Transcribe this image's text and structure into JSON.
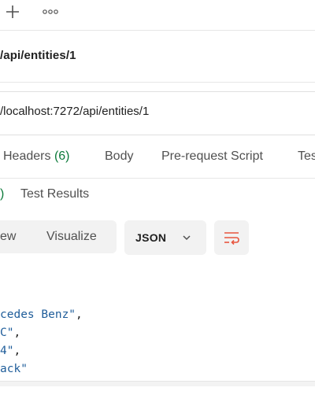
{
  "request": {
    "title": "/api/entities/1",
    "url": "/localhost:7272/api/entities/1"
  },
  "request_tabs": {
    "headers_label": "Headers",
    "headers_count": "(6)",
    "body_label": "Body",
    "prerequest_label": "Pre-request Script",
    "tests_label": "Tes"
  },
  "response_tabs": {
    "partial_count": ")",
    "test_results_label": "Test Results"
  },
  "view_controls": {
    "pretty_partial": "ew",
    "visualize_label": "Visualize",
    "format_value": "JSON"
  },
  "response_lines": [
    {
      "text": "cedes Benz\"",
      "trail": ","
    },
    {
      "text": "C\"",
      "trail": ","
    },
    {
      "text": "4\"",
      "trail": ","
    },
    {
      "text": "ack\"",
      "trail": ""
    }
  ],
  "colors": {
    "accent": "#e8553e",
    "count_green": "#0c7a3a",
    "json_string": "#1f5d9a"
  },
  "icons": {
    "new_tab": "plus-icon",
    "more": "ellipsis-icon",
    "dropdown": "chevron-down-icon",
    "wrap": "wrap-lines-icon"
  }
}
